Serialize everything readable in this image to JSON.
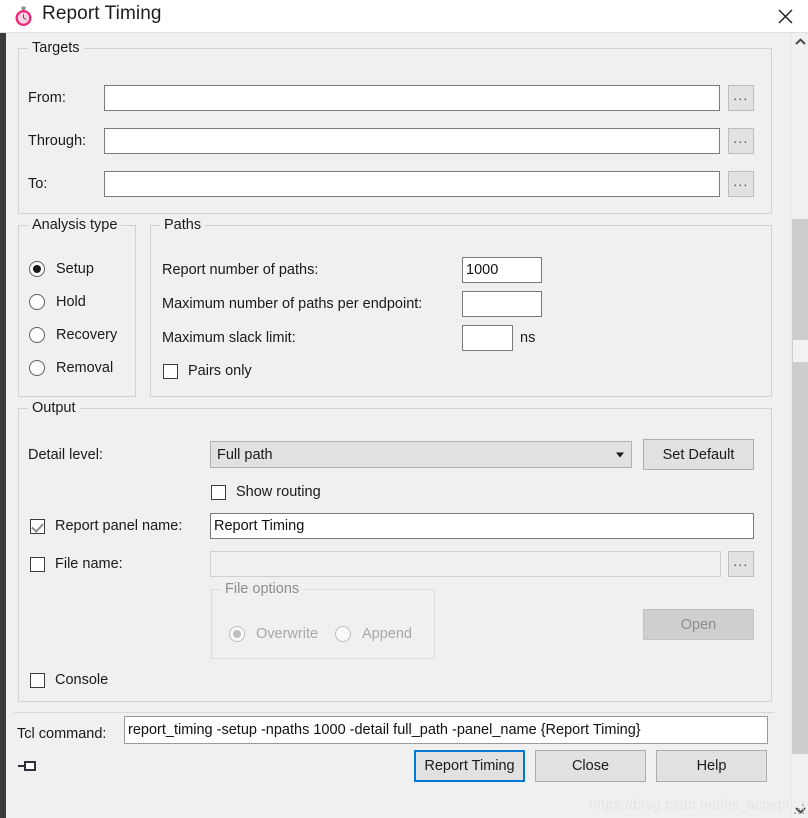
{
  "window": {
    "title": "Report Timing",
    "icon": "stopwatch-icon",
    "close_label": "✕"
  },
  "targets": {
    "legend": "Targets",
    "rows": [
      {
        "label": "From:",
        "value": "",
        "browse_label": "..."
      },
      {
        "label": "Through:",
        "value": "",
        "browse_label": "..."
      },
      {
        "label": "To:",
        "value": "",
        "browse_label": "..."
      }
    ]
  },
  "analysis_type": {
    "legend": "Analysis type",
    "selected": "Setup",
    "options": [
      {
        "label": "Setup",
        "checked": true
      },
      {
        "label": "Hold",
        "checked": false
      },
      {
        "label": "Recovery",
        "checked": false
      },
      {
        "label": "Removal",
        "checked": false
      }
    ]
  },
  "paths": {
    "legend": "Paths",
    "report_number_label": "Report number of paths:",
    "report_number_value": "1000",
    "max_paths_label": "Maximum number of paths per endpoint:",
    "max_paths_value": "",
    "max_slack_label": "Maximum slack limit:",
    "max_slack_value": "",
    "max_slack_unit": "ns",
    "pairs_only_label": "Pairs only",
    "pairs_only_checked": false
  },
  "output": {
    "legend": "Output",
    "detail_level_label": "Detail level:",
    "detail_level_value": "Full path",
    "detail_level_options": [
      "Full path"
    ],
    "set_default_label": "Set Default",
    "show_routing_label": "Show routing",
    "show_routing_checked": false,
    "report_panel_label": "Report panel name:",
    "report_panel_checked": true,
    "report_panel_value": "Report Timing",
    "file_name_label": "File name:",
    "file_name_checked": false,
    "file_name_value": "",
    "file_browse_label": "...",
    "file_options": {
      "legend": "File options",
      "overwrite_label": "Overwrite",
      "overwrite_checked": true,
      "append_label": "Append",
      "append_checked": false,
      "enabled": false
    },
    "open_label": "Open",
    "open_enabled": false,
    "console_label": "Console",
    "console_checked": false
  },
  "tcl": {
    "label": "Tcl command:",
    "value": "report_timing -setup -npaths 1000 -detail full_path -panel_name {Report Timing}"
  },
  "footer": {
    "primary_label": "Report Timing",
    "close_label": "Close",
    "help_label": "Help"
  },
  "watermark": "https://blog.csdn.net/lis_accept",
  "colors": {
    "dialog_bg": "#f0f0f0",
    "accent_focus": "#0078d7",
    "icon_pink": "#ec2a7b",
    "field_bg": "#ffffff"
  }
}
